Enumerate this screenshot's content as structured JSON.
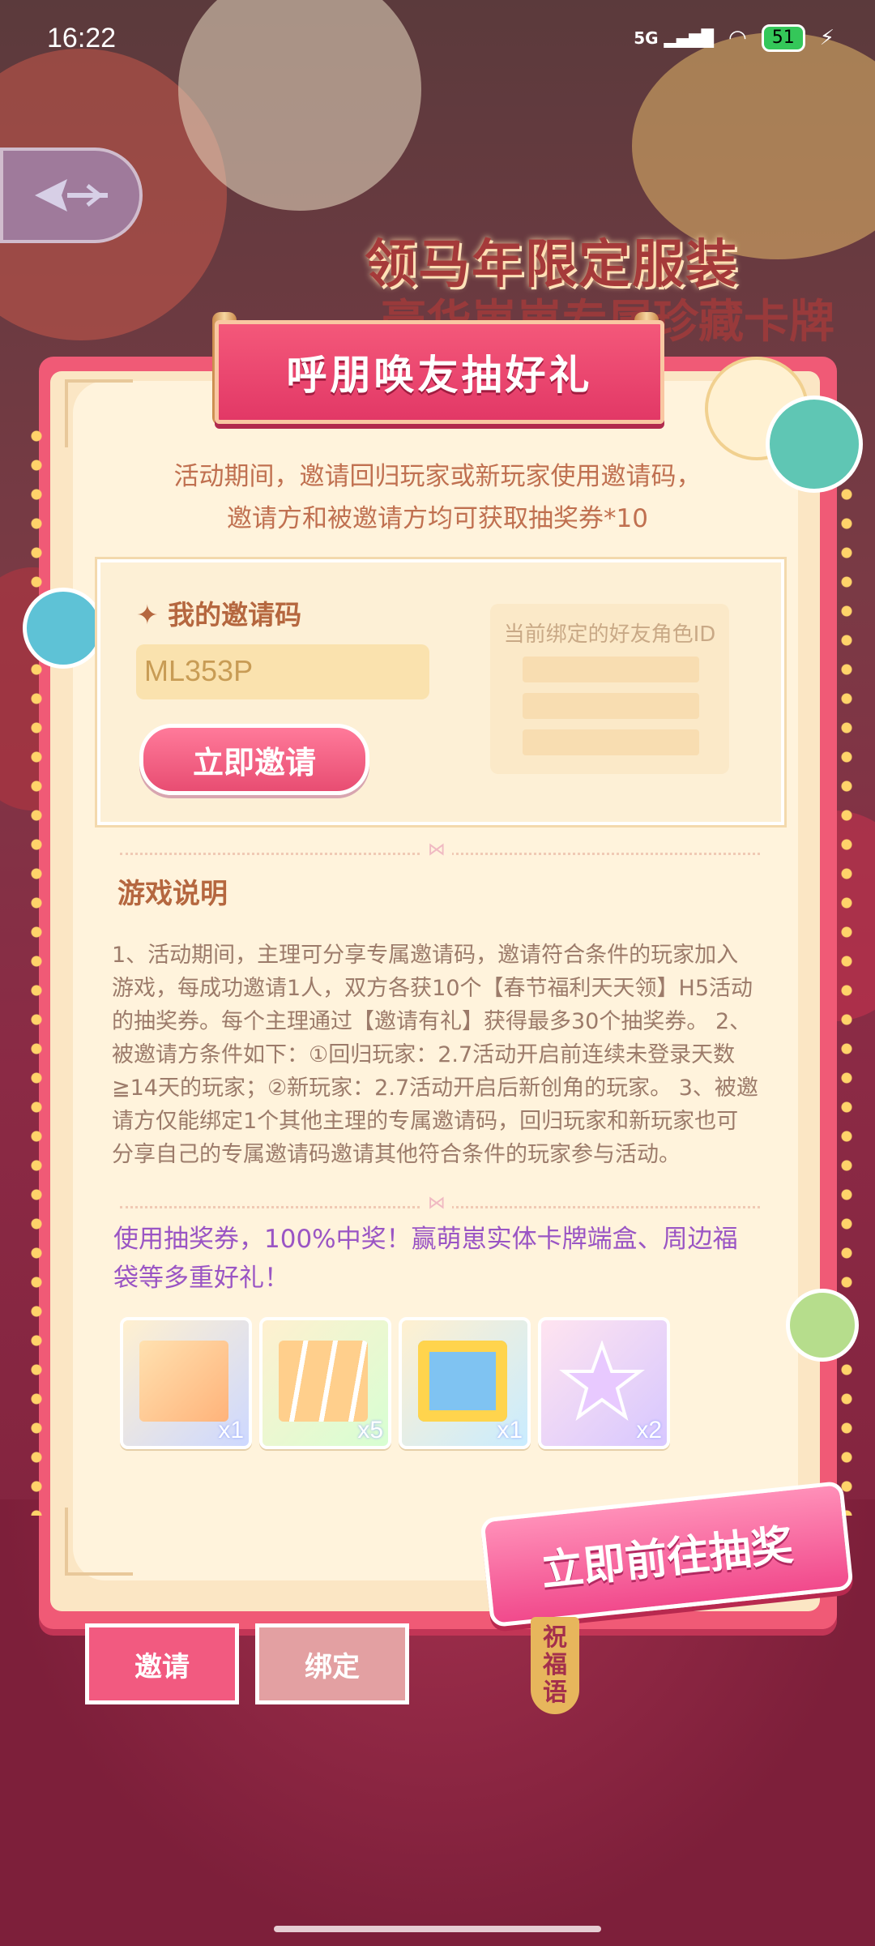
{
  "status_bar": {
    "time": "16:22",
    "network": "5G",
    "battery": "51"
  },
  "banner": {
    "title_line1": "领马年限定服装",
    "title_line2": "豪华崽崽专属珍藏卡牌"
  },
  "panel": {
    "title": "呼朋唤友抽好礼",
    "intro_line1": "活动期间，邀请回归玩家或新玩家使用邀请码，",
    "intro_line2": "邀请方和被邀请方均可获取抽奖券*10"
  },
  "invite": {
    "label": "✦ 我的邀请码",
    "code": "ML353P",
    "button": "立即邀请",
    "friend_label": "当前绑定的好友角色ID"
  },
  "rules": {
    "title": "游戏说明",
    "text": "1、活动期间，主理可分享专属邀请码，邀请符合条件的玩家加入游戏，每成功邀请1人，双方各获10个【春节福利天天领】H5活动的抽奖券。每个主理通过【邀请有礼】获得最多30个抽奖券。 2、被邀请方条件如下：①回归玩家：2.7活动开启前连续未登录天数≧14天的玩家；②新玩家：2.7活动开启后新创角的玩家。 3、被邀请方仅能绑定1个其他主理的专属邀请码，回归玩家和新玩家也可分享自己的专属邀请码邀请其他符合条件的玩家参与活动。"
  },
  "promo": "使用抽奖券，100%中奖！赢萌崽实体卡牌端盒、周边福袋等多重好礼！",
  "prizes": [
    {
      "qty": "x1",
      "icon": "card-box-icon"
    },
    {
      "qty": "x5",
      "icon": "card-packs-icon"
    },
    {
      "qty": "x1",
      "icon": "gift-box-icon"
    },
    {
      "qty": "x2",
      "icon": "star-icon"
    }
  ],
  "draw_button": "立即前往抽奖",
  "tabs": {
    "invite": "邀请",
    "bind": "绑定",
    "wish_line1": "祝",
    "wish_line2": "福",
    "wish_line3": "语"
  }
}
